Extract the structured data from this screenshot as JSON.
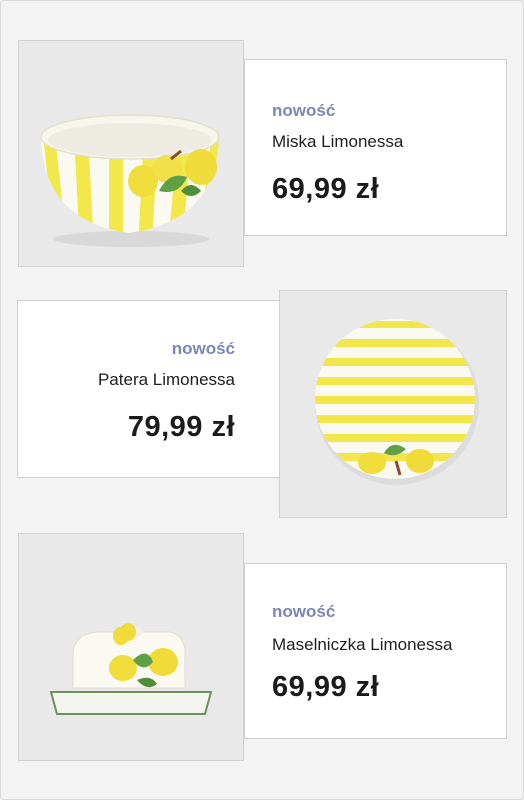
{
  "colors": {
    "badge": "#7e86b8",
    "accent_yellow": "#f3e64a",
    "leaf_green": "#6aa84f",
    "background": "#f3f3f3"
  },
  "products": [
    {
      "badge": "nowość",
      "name": "Miska Limonessa",
      "price": "69,99 zł",
      "image": "yellow-striped-bowl-with-lemons"
    },
    {
      "badge": "nowość",
      "name": "Patera Limonessa",
      "price": "79,99 zł",
      "image": "yellow-striped-plate-with-lemons"
    },
    {
      "badge": "nowość",
      "name": "Maselniczka Limonessa",
      "price": "69,99 zł",
      "image": "butter-dish-with-lemons"
    }
  ]
}
